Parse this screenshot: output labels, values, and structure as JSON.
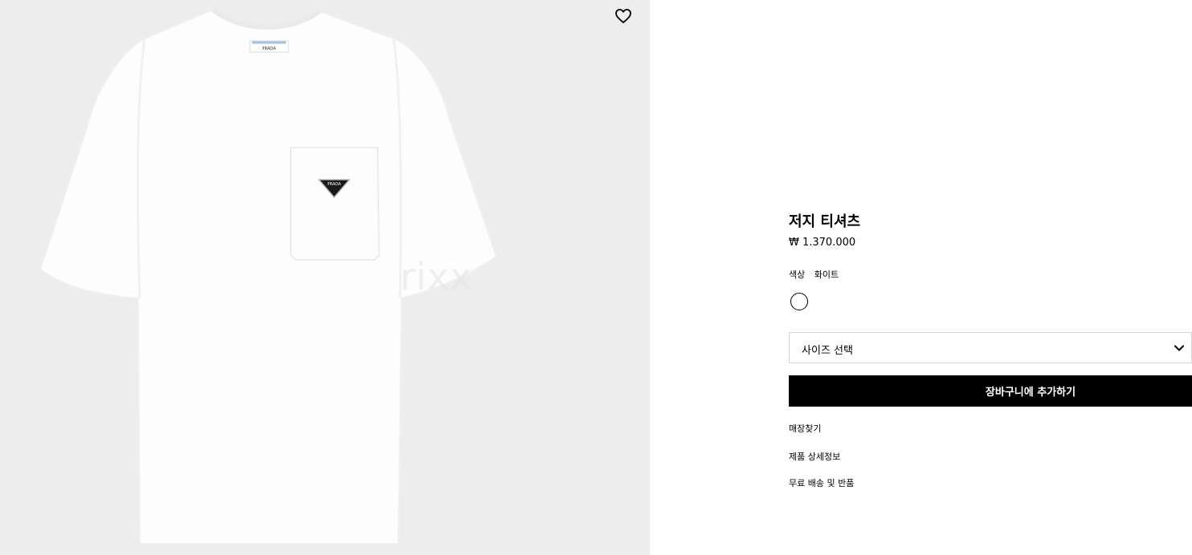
{
  "product": {
    "title": "저지 티셔츠",
    "price": "₩ 1.370.000",
    "image": {
      "subject": "white-tshirt-with-pocket-and-triangle-logo",
      "label_text": "PRADA",
      "watermark": "rixx"
    },
    "wishlist_icon": "heart-outline-icon"
  },
  "color": {
    "label": "색상",
    "value": "화이트",
    "swatch_color": "#ffffff"
  },
  "size_select": {
    "placeholder": "사이즈 선택",
    "icon": "chevron-down-icon"
  },
  "add_to_cart": {
    "label": "장바구니에 추가하기",
    "bg_color": "#000000",
    "text_color": "#ffffff"
  },
  "links": [
    {
      "label": "매장찾기"
    },
    {
      "label": "제품 상세정보"
    },
    {
      "label": "무료 배송 및 반품"
    }
  ],
  "colors": {
    "image_bg": "#ededed",
    "page_bg": "#ffffff",
    "border": "#d5d5d5"
  }
}
